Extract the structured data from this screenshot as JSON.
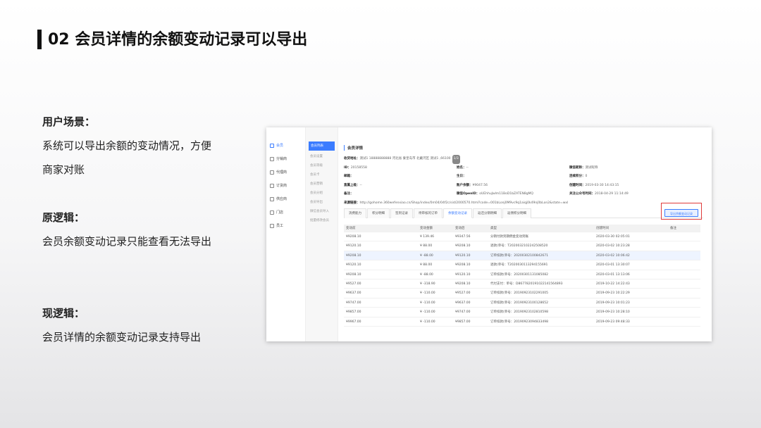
{
  "title": "02 会员详情的余额变动记录可以导出",
  "sections": [
    {
      "head": "用户场景：",
      "body": "系统可以导出余额的变动情况，方便商家对账"
    },
    {
      "head": "原逻辑：",
      "body": "会员余额变动记录只能查看无法导出"
    },
    {
      "head": "现逻辑：",
      "body": "会员详情的余额变动记录支持导出"
    }
  ],
  "screenshot": {
    "nav_primary": [
      "会员",
      "分销商",
      "代理商",
      "订货商",
      "供应商",
      "门店",
      "员工"
    ],
    "nav_secondary": [
      "会员列表",
      "会员设置",
      "会员等级",
      "会员卡",
      "会员营销",
      "会员分组",
      "会员导出",
      "微信会员导入",
      "批量修改会员"
    ],
    "page_title": "会员详情",
    "info": {
      "address_label": "收货地址：",
      "address_value": "测试1 18888888888 河北省 秦皇岛市 北戴河区 测试1 ,66100",
      "address_badge": "1/3",
      "id_label": "ID：",
      "id_value": "20158558",
      "name_label": "姓名：",
      "name_value": "--",
      "nickname_label": "微信昵称：",
      "nickname_value": "测试昵称",
      "email_label": "邮箱：",
      "email_value": "",
      "birthday_label": "生日：",
      "birthday_value": "",
      "points_label": "连续积分：",
      "points_value": "0",
      "parent_label": "直属上级：",
      "parent_value": "--",
      "balance_label": "账户余额：",
      "balance_value": "¥9047.56",
      "created_label": "创建时间：",
      "created_value": "2019-03-30 14:43:15",
      "remark_label": "备注：",
      "remark_value": "",
      "openid_label": "微信OpenID：",
      "openid_value": "oUEhhuJwlm11BoD1bZATEN8gMQ",
      "follow_label": "关注公众号时间：",
      "follow_value": "2018-04-29 11:14:49",
      "source_label": "来源链接：",
      "source_value": "http://gohome.360wefenxiao.cn/Shop/index/0m04/04f2c/sid/2000570.html?code=001bLonj0M9vc9q1aiqj0k49nj0bLon2&state=wxl"
    },
    "tabs": [
      "消费能力",
      "积分明细",
      "签到记录",
      "待审核的订单",
      "余额变动记录",
      "返还分销明细",
      "返佣积分明细"
    ],
    "active_tab": "余额变动记录",
    "export_label": "导出余额变动记录",
    "table": {
      "columns": [
        "变动前",
        "变动金额",
        "变动后",
        "类型",
        "创建时间",
        "备注"
      ],
      "rows": [
        [
          "¥9208.10",
          "¥ 139.46",
          "¥9347.56",
          "分销付款到期佣金变动到账",
          "2020-03-30 02:05:01",
          ""
        ],
        [
          "¥9120.10",
          "¥ 88.00",
          "¥9208.10",
          "退款(单号：T2020032102242508520",
          "2020-03-02 10:23:28",
          ""
        ],
        [
          "¥9208.10",
          "¥ -88.00",
          "¥9120.10",
          "订单扣款(单号：20200302100842671",
          "2020-03-02 10:06:42",
          ""
        ],
        [
          "¥9120.10",
          "¥ 88.00",
          "¥9208.10",
          "退款(单号：T2020030113294155691",
          "2020-03-01 13:30:07",
          ""
        ],
        [
          "¥9208.10",
          "¥ -88.00",
          "¥9120.10",
          "订单扣款(单号：20200301131085082",
          "2020-03-01 13:13:06",
          ""
        ],
        [
          "¥9527.00",
          "¥ -318.90",
          "¥9208.10",
          "代付支付：单号：D8677820191022141564893",
          "2019-10-22 14:22:43",
          ""
        ],
        [
          "¥9637.00",
          "¥ -110.00",
          "¥9527.00",
          "订单扣款(单号：20190923102291005",
          "2019-09-23 10:22:29",
          ""
        ],
        [
          "¥9747.00",
          "¥ -110.00",
          "¥9637.00",
          "订单扣款(单号：20190923100128652",
          "2019-09-23 10:01:23",
          ""
        ],
        [
          "¥9857.00",
          "¥ -110.00",
          "¥9747.00",
          "订单扣款(单号：20190923102810598",
          "2019-09-23 10:28:10",
          ""
        ],
        [
          "¥9967.00",
          "¥ -110.00",
          "¥9857.00",
          "订单扣款(单号：20190923094833498",
          "2019-09-23 09:48:33",
          ""
        ]
      ]
    }
  }
}
